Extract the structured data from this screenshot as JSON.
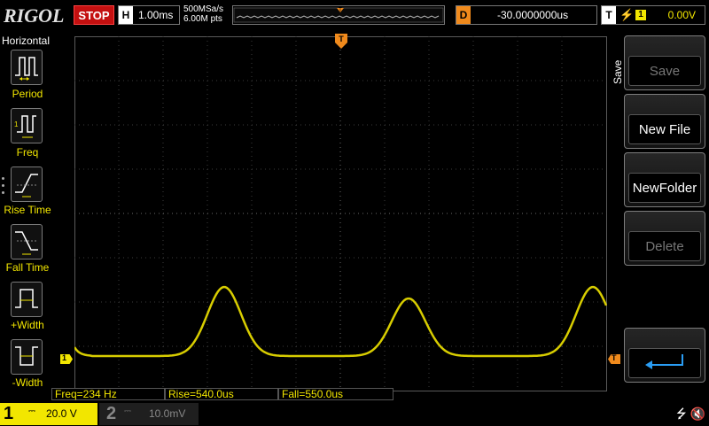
{
  "header": {
    "logo": "RIGOL",
    "run_state": "STOP",
    "timebase_key": "H",
    "timebase": "1.00ms",
    "sample_rate": "500MSa/s",
    "memory_depth": "6.00M pts",
    "delay_key": "D",
    "delay": "-30.0000000us",
    "trigger_key": "T",
    "trigger_edge": "rising-edge-icon",
    "trigger_source": "1",
    "trigger_level": "0.00V",
    "trigger_marker": "T"
  },
  "left_menu": {
    "title": "Horizontal",
    "items": [
      {
        "label": "Period",
        "icon": "period-icon"
      },
      {
        "label": "Freq",
        "icon": "frequency-icon"
      },
      {
        "label": "Rise Time",
        "icon": "rise-time-icon"
      },
      {
        "label": "Fall Time",
        "icon": "fall-time-icon"
      },
      {
        "label": "+Width",
        "icon": "positive-width-icon"
      },
      {
        "label": "-Width",
        "icon": "negative-width-icon"
      }
    ]
  },
  "measurements": {
    "freq": "Freq=234 Hz",
    "rise": "Rise=540.0us",
    "fall": "Fall=550.0us"
  },
  "markers": {
    "ch1_ground": "1",
    "trigger_level": "T"
  },
  "right_menu": {
    "title": "Save",
    "buttons": [
      {
        "label": "Save",
        "enabled": false
      },
      {
        "label": "New File",
        "enabled": true
      },
      {
        "label": "NewFolder",
        "enabled": true
      },
      {
        "label": "Delete",
        "enabled": false
      },
      {
        "label": "",
        "icon": "return-arrow-icon",
        "enabled": true
      }
    ]
  },
  "channels": {
    "ch1": {
      "number": "1",
      "coupling": "DC",
      "scale": "20.0 V",
      "color": "#f2e600"
    },
    "ch2": {
      "number": "2",
      "coupling": "DC",
      "scale": "10.0mV",
      "color": "#888888"
    }
  },
  "status": {
    "usb_icon": "usb-icon",
    "sound_icon": "speaker-muted-icon"
  }
}
